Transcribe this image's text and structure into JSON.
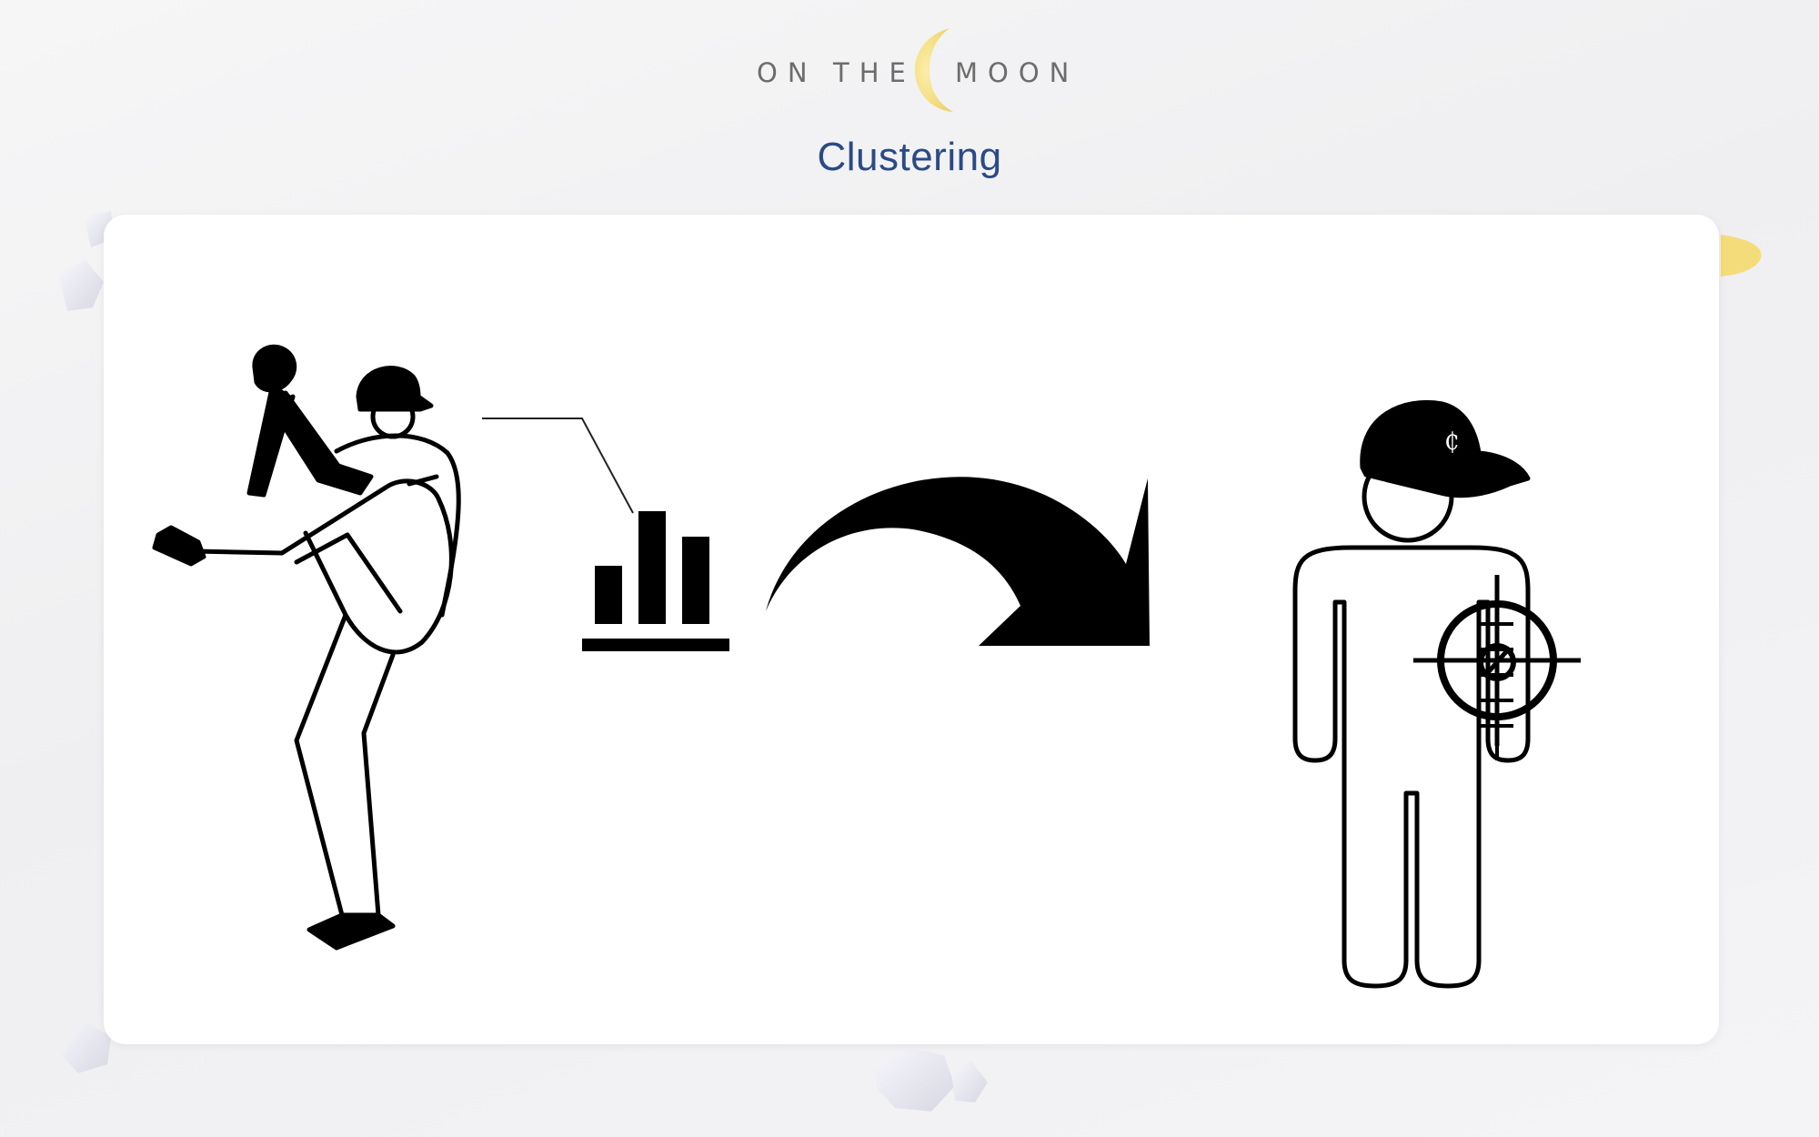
{
  "logo": {
    "word_on": "ON",
    "word_the": "THE",
    "word_moon": "MOON",
    "moon_color": "#f2da74"
  },
  "page": {
    "title": "Clustering",
    "title_color": "#2b4a86"
  },
  "figure": {
    "icons": [
      "baseball-pitcher-icon",
      "bar-chart-icon",
      "curved-arrow-icon",
      "target-player-icon"
    ],
    "cap_logo_glyph": "₵"
  }
}
